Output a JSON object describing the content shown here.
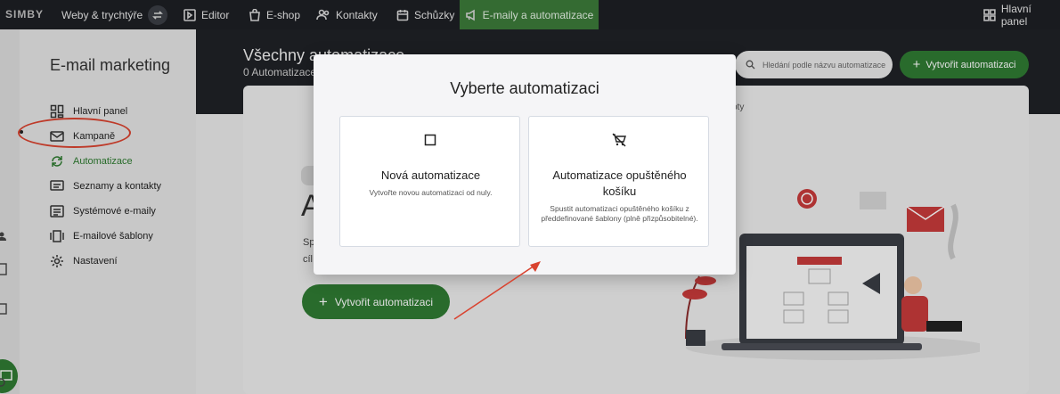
{
  "topnav": {
    "logo": "SIMBY",
    "sites": "Weby & trychtýře",
    "editor": "Editor",
    "eshop": "E-shop",
    "contacts": "Kontakty",
    "meetings": "Schůzky",
    "email": "E-maily a automatizace",
    "dashboard": "Hlavní panel"
  },
  "sidebar": {
    "title": "E-mail marketing",
    "items": [
      {
        "label": "Hlavní panel",
        "icon": "dashboard-icon"
      },
      {
        "label": "Kampaně",
        "icon": "mail-icon"
      },
      {
        "label": "Automatizace",
        "icon": "refresh-icon",
        "active": true
      },
      {
        "label": "Seznamy a kontakty",
        "icon": "list-icon"
      },
      {
        "label": "Systémové e-maily",
        "icon": "system-mail-icon"
      },
      {
        "label": "E-mailové šablony",
        "icon": "template-icon"
      },
      {
        "label": "Nastavení",
        "icon": "gear-icon"
      }
    ]
  },
  "main": {
    "title": "Všechny automatizace",
    "subtitle": "0 Automatizace",
    "search_placeholder": "Hledání podle názvu automatizace",
    "create_button": "Vytvořit automatizaci",
    "empty_label": "pty",
    "heading_partial": "A",
    "desc_line1": "Sp",
    "desc_line2": "cíl",
    "create_main_button": "Vytvořit automatizaci"
  },
  "modal": {
    "title": "Vyberte automatizaci",
    "options": [
      {
        "title": "Nová automatizace",
        "description": "Vytvořte novou automatizaci od nuly.",
        "icon": "square-icon"
      },
      {
        "title": "Automatizace opuštěného košíku",
        "description": "Spustit automatizaci opuštěného košíku z předdefinované šablony (plně přizpůsobitelné).",
        "icon": "cart-off-icon"
      }
    ]
  },
  "colors": {
    "accent_green": "#2f7a33",
    "nav_dark": "#1d1f24",
    "annotation_red": "#d9432f"
  }
}
